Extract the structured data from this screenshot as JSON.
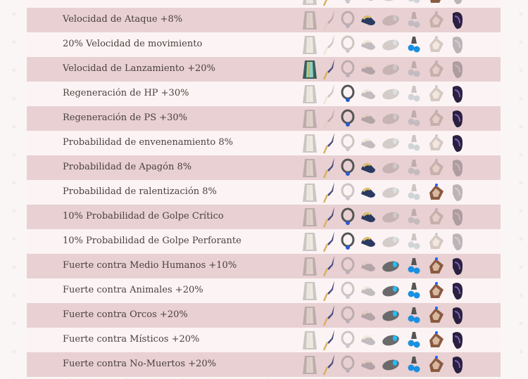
{
  "slots": [
    "armor",
    "weapon",
    "helmet",
    "shoes",
    "shield",
    "earrings",
    "bracelet",
    "necklace"
  ],
  "rows": [
    {
      "label": "",
      "active": [
        0,
        1,
        0,
        0,
        0,
        0,
        1,
        0
      ]
    },
    {
      "label": "Velocidad de Ataque +8%",
      "active": [
        0,
        0,
        0,
        1,
        0,
        0,
        0,
        1
      ]
    },
    {
      "label": "20% Velocidad de movimiento",
      "active": [
        0,
        0,
        0,
        0,
        0,
        1,
        0,
        0
      ]
    },
    {
      "label": "Velocidad de Lanzamiento +20%",
      "active": [
        1,
        1,
        0,
        0,
        0,
        0,
        0,
        0
      ]
    },
    {
      "label": "Regeneración de HP +30%",
      "active": [
        0,
        0,
        1,
        0,
        0,
        0,
        0,
        1
      ]
    },
    {
      "label": "Regeneración de PS +30%",
      "active": [
        0,
        0,
        1,
        0,
        0,
        0,
        0,
        1
      ]
    },
    {
      "label": "Probabilidad de envenenamiento 8%",
      "active": [
        0,
        1,
        0,
        0,
        0,
        0,
        0,
        1
      ]
    },
    {
      "label": "Probabilidad de Apagón 8%",
      "active": [
        0,
        1,
        1,
        1,
        0,
        0,
        0,
        0
      ]
    },
    {
      "label": "Probabilidad de ralentización 8%",
      "active": [
        0,
        1,
        0,
        1,
        0,
        0,
        1,
        0
      ]
    },
    {
      "label": "10% Probabilidad de Golpe Crítico",
      "active": [
        0,
        1,
        1,
        1,
        0,
        0,
        0,
        0
      ]
    },
    {
      "label": "10% Probabilidad de Golpe Perforante",
      "active": [
        0,
        1,
        1,
        1,
        0,
        0,
        0,
        0
      ]
    },
    {
      "label": "Fuerte contra Medio Humanos +10%",
      "active": [
        0,
        1,
        0,
        0,
        1,
        1,
        1,
        1
      ]
    },
    {
      "label": "Fuerte contra Animales +20%",
      "active": [
        0,
        1,
        0,
        0,
        1,
        1,
        1,
        1
      ]
    },
    {
      "label": "Fuerte contra Orcos +20%",
      "active": [
        0,
        1,
        0,
        0,
        1,
        1,
        1,
        1
      ]
    },
    {
      "label": "Fuerte contra Místicos +20%",
      "active": [
        0,
        1,
        0,
        0,
        1,
        1,
        1,
        1
      ]
    },
    {
      "label": "Fuerte contra No-Muertos +20%",
      "active": [
        0,
        1,
        0,
        0,
        1,
        1,
        1,
        1
      ]
    }
  ]
}
